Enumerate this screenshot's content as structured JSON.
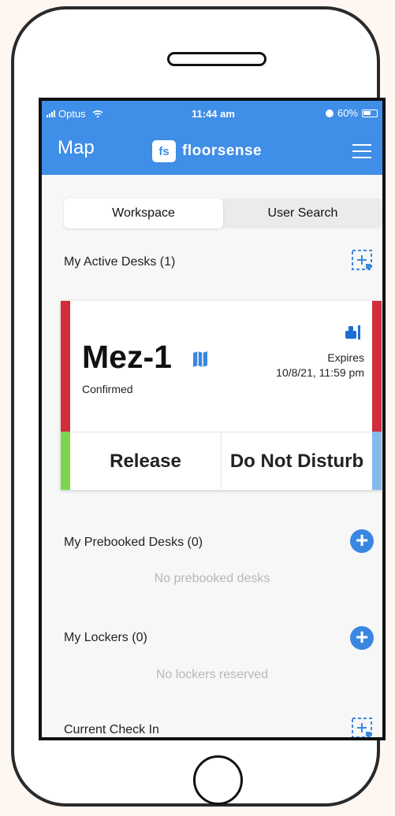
{
  "status_bar": {
    "carrier": "Optus",
    "time": "11:44 am",
    "battery": "60%"
  },
  "nav": {
    "map_label": "Map",
    "brand_badge": "fs",
    "brand_name": "floorsense"
  },
  "tabs": [
    {
      "label": "Workspace",
      "active": true
    },
    {
      "label": "User Search",
      "active": false
    }
  ],
  "sections": {
    "active_desks": {
      "title": "My Active Desks (1)",
      "desk": {
        "name": "Mez-1",
        "status": "Confirmed",
        "expires_label": "Expires",
        "expires_date": "10/8/21, 11:59 pm",
        "release_label": "Release",
        "dnd_label": "Do Not Disturb"
      }
    },
    "prebooked": {
      "title": "My Prebooked Desks (0)",
      "empty": "No prebooked desks"
    },
    "lockers": {
      "title": "My Lockers (0)",
      "empty": "No lockers reserved"
    },
    "check_in": {
      "title": "Current Check In"
    }
  },
  "colors": {
    "brand_blue": "#3f8ee7",
    "status_red": "#d12d3b",
    "status_green": "#7cd64d",
    "status_light_blue": "#86b9ec"
  },
  "icons": {
    "scan": "scan-icon",
    "add": "add-circle-icon",
    "menu": "hamburger-menu-icon",
    "map_pin": "map-pin-icon"
  }
}
